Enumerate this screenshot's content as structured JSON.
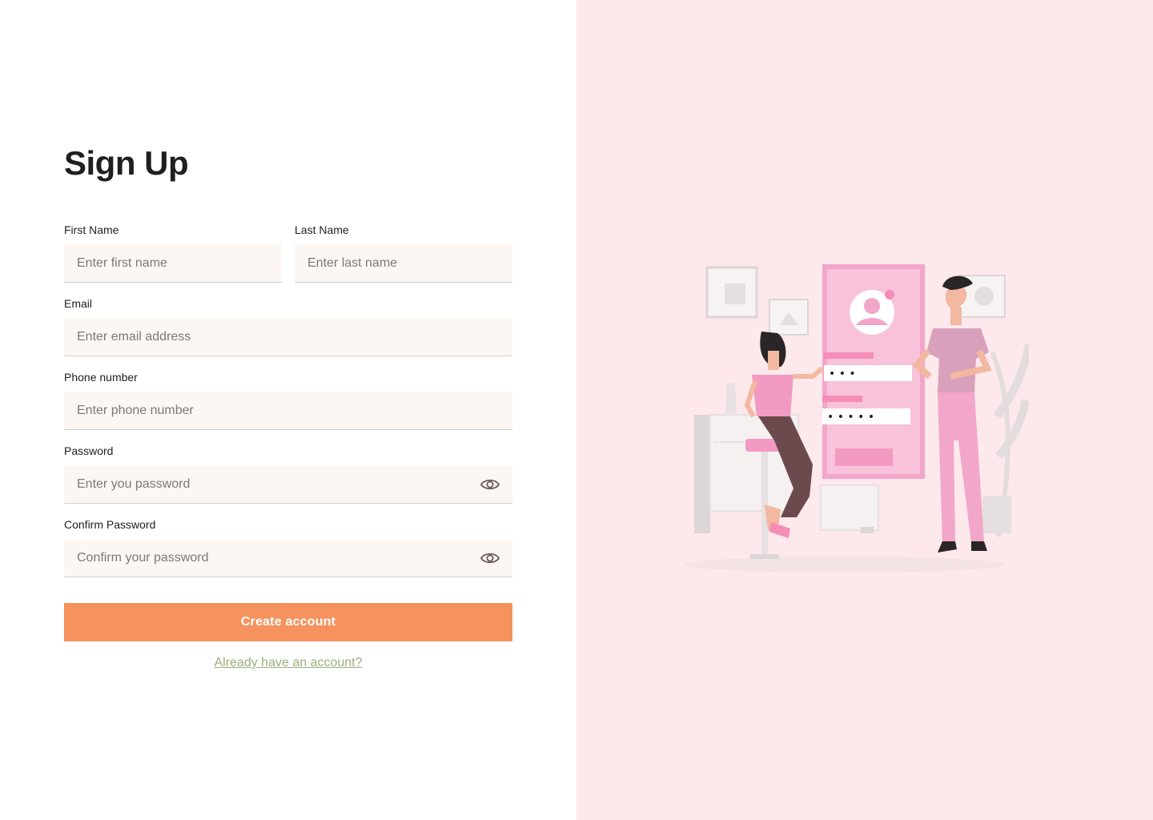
{
  "page": {
    "title": "Sign Up"
  },
  "form": {
    "first_name": {
      "label": "First Name",
      "placeholder": "Enter first name",
      "value": ""
    },
    "last_name": {
      "label": "Last Name",
      "placeholder": "Enter last name",
      "value": ""
    },
    "email": {
      "label": "Email",
      "placeholder": "Enter email address",
      "value": ""
    },
    "phone": {
      "label": "Phone number",
      "placeholder": "Enter phone number",
      "value": ""
    },
    "password": {
      "label": "Password",
      "placeholder": "Enter you password",
      "value": "",
      "toggle_icon": "eye-icon"
    },
    "confirm_password": {
      "label": "Confirm Password",
      "placeholder": "Confirm your password",
      "value": "",
      "toggle_icon": "eye-icon"
    }
  },
  "actions": {
    "create_account_label": "Create account",
    "login_link_label": "Already have an account?"
  },
  "colors": {
    "accent": "#f5925e",
    "link": "#9bb07c",
    "panel_bg": "#fde8ec",
    "field_bg": "#fdf7f3"
  },
  "illustration": {
    "icon": "signup-illustration",
    "password_dots_1": "• • •",
    "password_dots_2": "• • • • •"
  }
}
